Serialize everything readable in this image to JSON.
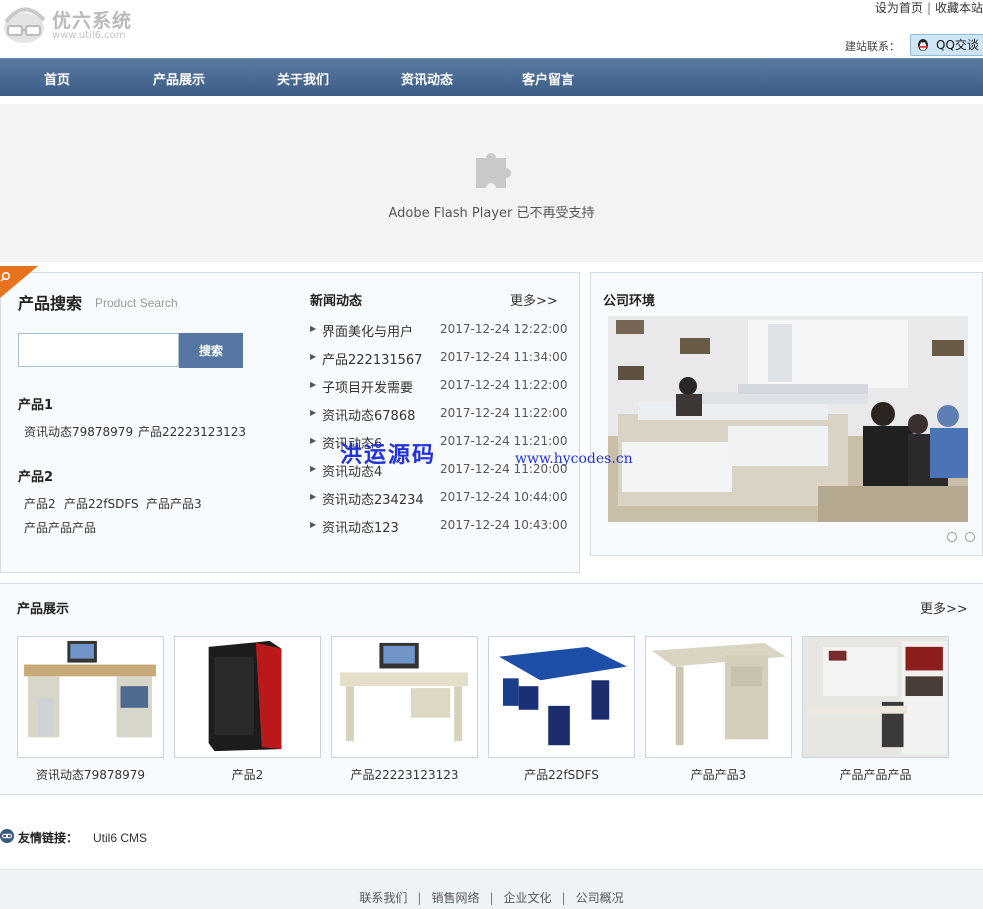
{
  "header": {
    "logo_name": "优六系统",
    "logo_url": "www.util6.com",
    "set_home": "设为首页",
    "sep": "|",
    "bookmark": "收藏本站",
    "contact_label": "建站联系：",
    "qq_label": "QQ交谈"
  },
  "nav": {
    "items": [
      {
        "label": "首页"
      },
      {
        "label": "产品展示"
      },
      {
        "label": "关于我们"
      },
      {
        "label": "资讯动态"
      },
      {
        "label": "客户留言"
      }
    ]
  },
  "banner": {
    "message": "Adobe Flash Player 已不再受支持"
  },
  "product_search": {
    "title": "产品搜索",
    "subtitle": "Product Search",
    "input_value": "",
    "button_label": "搜索",
    "categories": [
      {
        "title": "产品1",
        "links": [
          "资讯动态79878979",
          "产品22223123123"
        ]
      },
      {
        "title": "产品2",
        "links": [
          "产品2",
          "产品22fSDFS",
          "产品产品3",
          "产品产品产品"
        ]
      }
    ]
  },
  "news": {
    "title": "新闻动态",
    "more": "更多>>",
    "items": [
      {
        "title": "界面美化与用户",
        "date": "2017-12-24 12:22:00"
      },
      {
        "title": "产品222131567",
        "date": "2017-12-24 11:34:00"
      },
      {
        "title": "子项目开发需要",
        "date": "2017-12-24 11:22:00"
      },
      {
        "title": "资讯动态67868",
        "date": "2017-12-24 11:22:00"
      },
      {
        "title": "资讯动态6",
        "date": "2017-12-24 11:21:00"
      },
      {
        "title": "资讯动态4",
        "date": "2017-12-24 11:20:00"
      },
      {
        "title": "资讯动态234234",
        "date": "2017-12-24 10:44:00"
      },
      {
        "title": "资讯动态123",
        "date": "2017-12-24 10:43:00"
      }
    ]
  },
  "environment": {
    "title": "公司环境"
  },
  "watermark": {
    "text": "洪运源码",
    "url": "www.hycodes.cn"
  },
  "products": {
    "title": "产品展示",
    "more": "更多>>",
    "items": [
      {
        "name": "资讯动态79878979"
      },
      {
        "name": "产品2"
      },
      {
        "name": "产品22223123123"
      },
      {
        "name": "产品22fSDFS"
      },
      {
        "name": "产品产品3"
      },
      {
        "name": "产品产品产品"
      }
    ]
  },
  "friend_links": {
    "label": "友情链接：",
    "items": [
      "Util6 CMS"
    ]
  },
  "footer": {
    "links": [
      "联系我们",
      "销售网络",
      "企业文化",
      "公司概况"
    ],
    "sep": "|"
  },
  "colors": {
    "nav_bg": "#4a6b94",
    "button_bg": "#5677a3",
    "watermark": "#2233dd",
    "corner_tag": "#e8731e"
  }
}
